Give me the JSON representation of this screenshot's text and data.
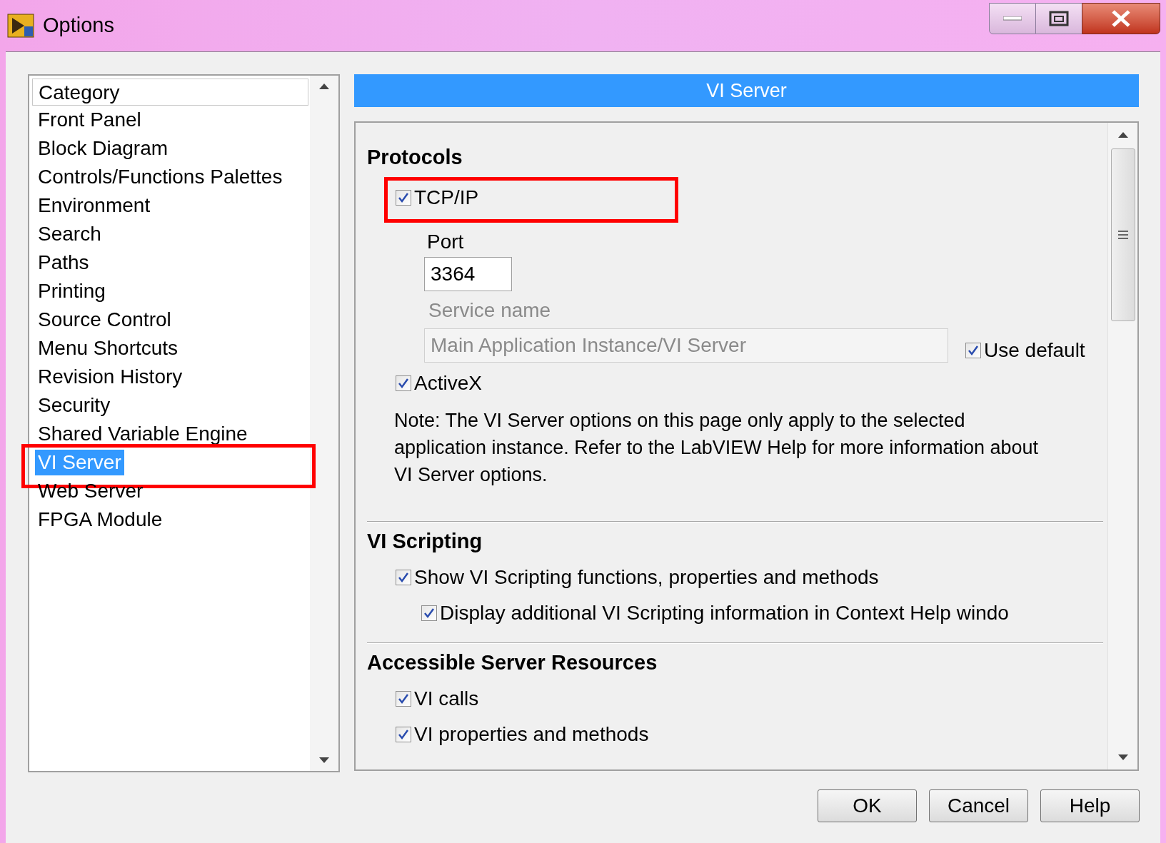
{
  "window": {
    "title": "Options"
  },
  "category_list": {
    "header": "Category",
    "items": [
      {
        "label": "Front Panel",
        "selected": false,
        "highlight": false
      },
      {
        "label": "Block Diagram",
        "selected": false,
        "highlight": false
      },
      {
        "label": "Controls/Functions Palettes",
        "selected": false,
        "highlight": false
      },
      {
        "label": "Environment",
        "selected": false,
        "highlight": false
      },
      {
        "label": "Search",
        "selected": false,
        "highlight": false
      },
      {
        "label": "Paths",
        "selected": false,
        "highlight": false
      },
      {
        "label": "Printing",
        "selected": false,
        "highlight": false
      },
      {
        "label": "Source Control",
        "selected": false,
        "highlight": false
      },
      {
        "label": "Menu Shortcuts",
        "selected": false,
        "highlight": false
      },
      {
        "label": "Revision History",
        "selected": false,
        "highlight": false
      },
      {
        "label": "Security",
        "selected": false,
        "highlight": false
      },
      {
        "label": "Shared Variable Engine",
        "selected": false,
        "highlight": false
      },
      {
        "label": "VI Server",
        "selected": true,
        "highlight": true
      },
      {
        "label": "Web Server",
        "selected": false,
        "highlight": false
      },
      {
        "label": "FPGA Module",
        "selected": false,
        "highlight": false
      }
    ]
  },
  "page_header": "VI Server",
  "sections": [
    {
      "heading": "Protocols",
      "items": [
        {
          "kind": "checkbox",
          "label": "TCP/IP",
          "checked": true,
          "highlight": true,
          "children": [
            {
              "kind": "field",
              "label": "Port",
              "value": "3364",
              "disabled": false
            },
            {
              "kind": "field",
              "label": "Service name",
              "value": "Main Application Instance/VI Server",
              "disabled": true,
              "use_default": {
                "label": "Use default",
                "checked": true
              }
            }
          ]
        },
        {
          "kind": "checkbox",
          "label": "ActiveX",
          "checked": true,
          "highlight": false
        },
        {
          "kind": "note",
          "text": "Note: The VI Server options on this page only apply to the selected application instance. Refer to the LabVIEW Help for more information about VI Server options."
        }
      ]
    },
    {
      "heading": "VI Scripting",
      "items": [
        {
          "kind": "checkbox",
          "label": "Show VI Scripting functions, properties and methods",
          "checked": true,
          "highlight": false,
          "children": [
            {
              "kind": "checkbox",
              "label": "Display additional VI Scripting information in Context Help windo",
              "checked": true,
              "highlight": false
            }
          ]
        }
      ]
    },
    {
      "heading": "Accessible Server Resources",
      "items": [
        {
          "kind": "checkbox",
          "label": "VI calls",
          "checked": true,
          "highlight": false
        },
        {
          "kind": "checkbox",
          "label": "VI properties and methods",
          "checked": true,
          "highlight": false
        }
      ]
    }
  ],
  "buttons": [
    "OK",
    "Cancel",
    "Help"
  ]
}
